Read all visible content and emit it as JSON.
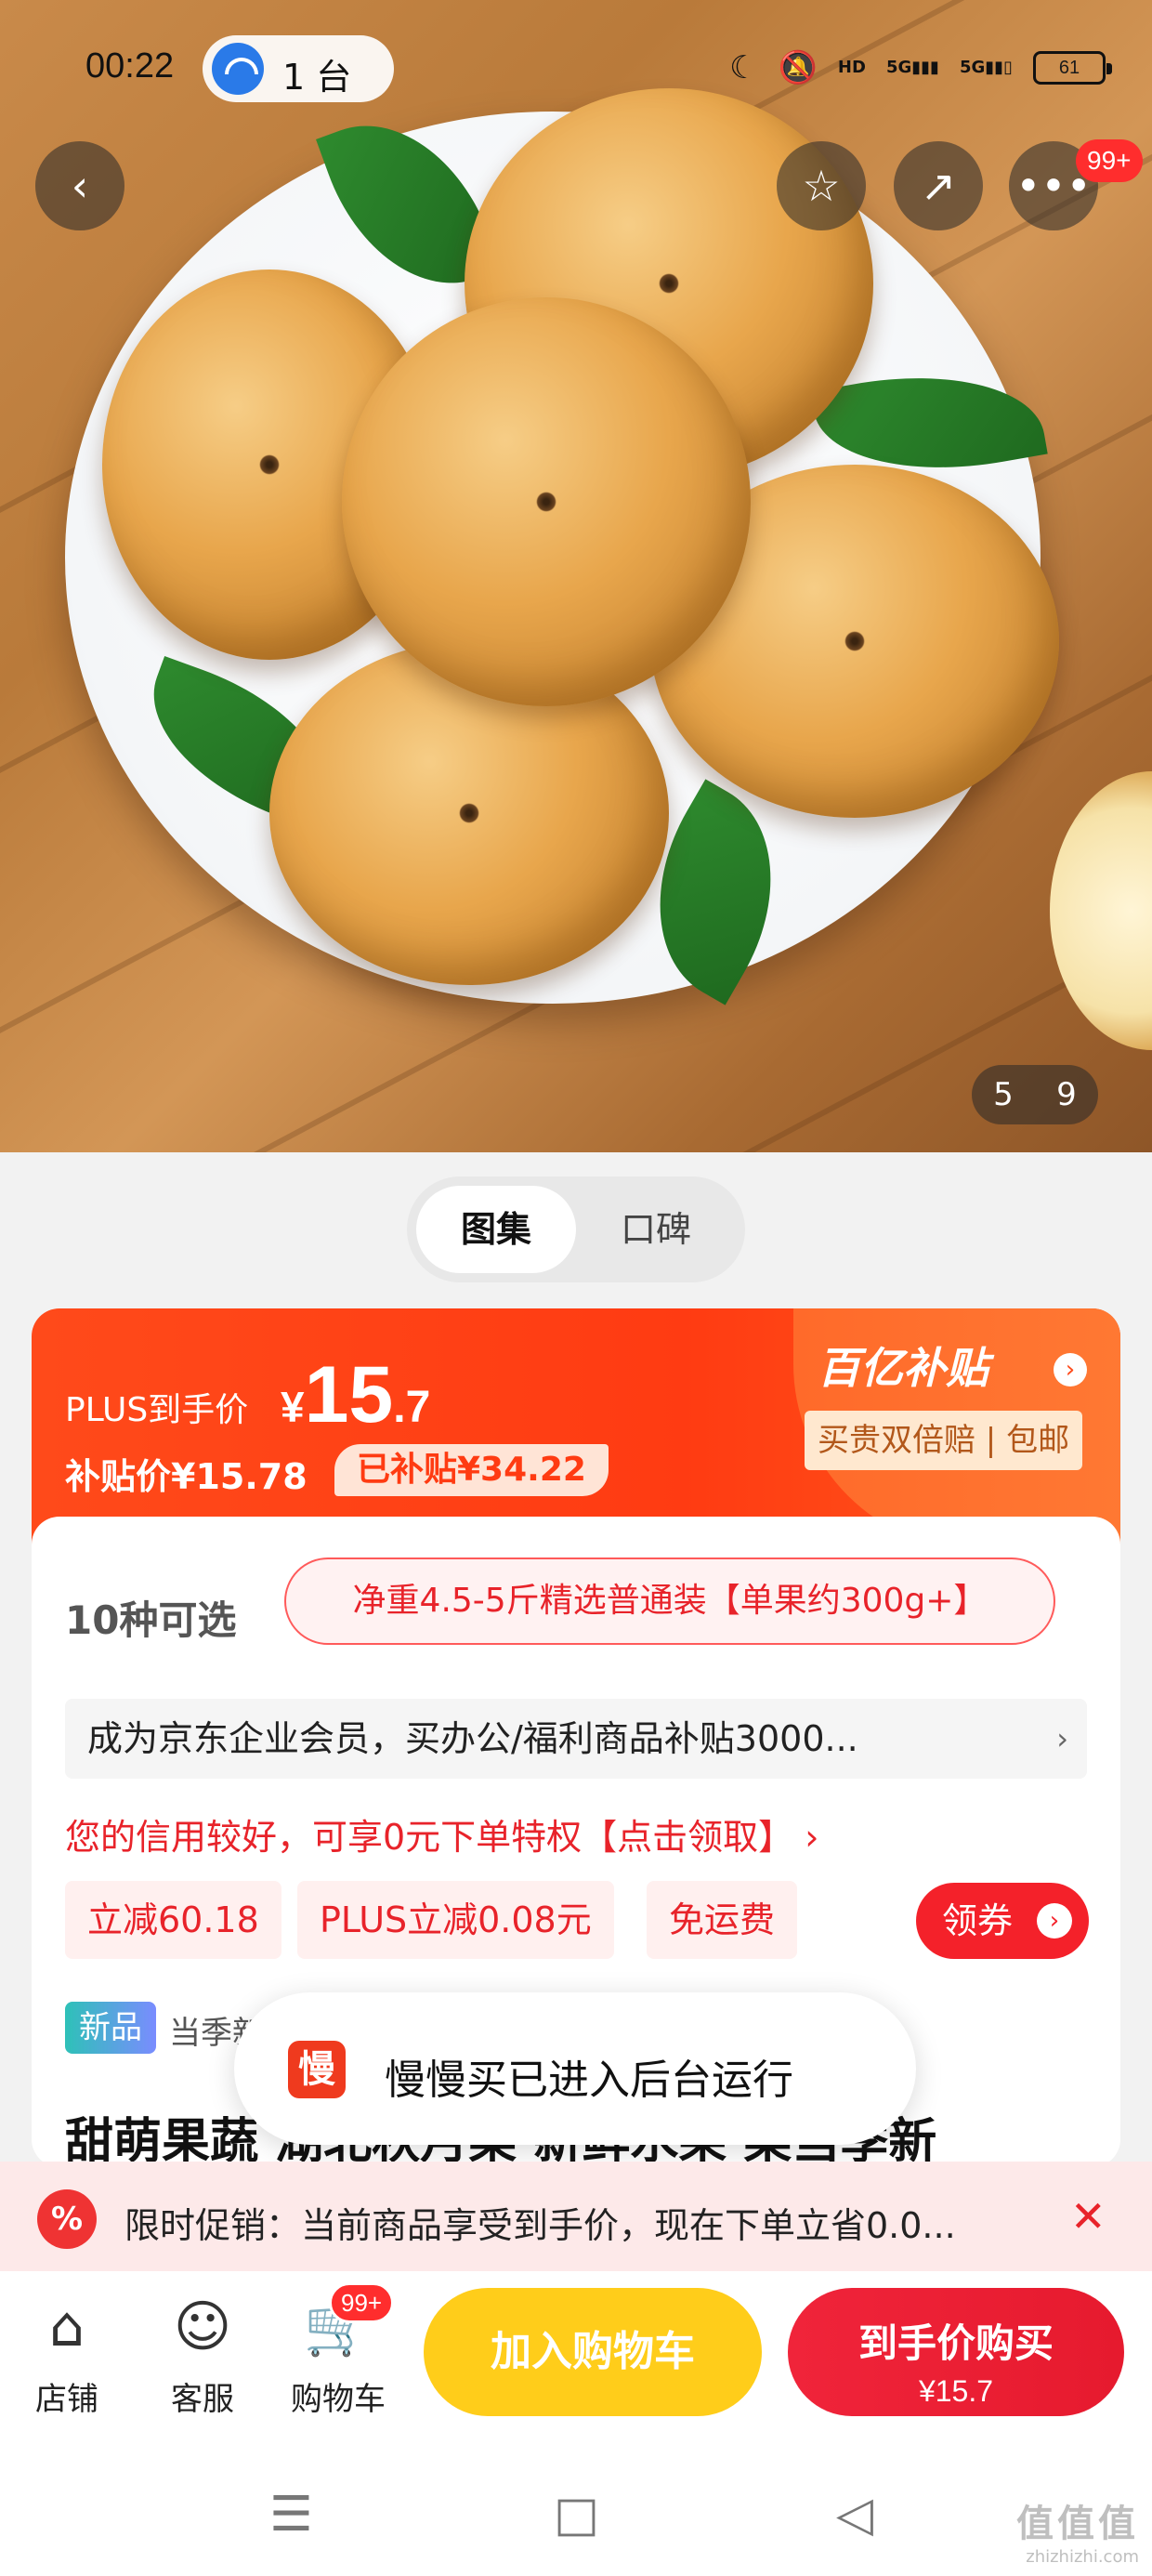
{
  "status_bar": {
    "time": "00:22",
    "hotspot_count": "1 台",
    "icons": [
      "moon-icon",
      "mute-icon",
      "hd-icon",
      "5g-signal-icon",
      "5g-signal-icon"
    ],
    "hd_label": "HD",
    "signal1": "5G",
    "signal2": "5G",
    "battery": "61"
  },
  "hero": {
    "cart_badge": "99+",
    "image_index": "5",
    "image_total": "9"
  },
  "tabs": [
    {
      "label": "图集",
      "active": true
    },
    {
      "label": "口碑",
      "active": false
    }
  ],
  "price_banner": {
    "plus_label": "PLUS到手价",
    "currency": "¥",
    "price_int": "15",
    "price_dec": ".7",
    "subsidy_price": "补贴价¥15.78",
    "subsidy_tag": "已补贴¥34.22",
    "program_title": "百亿补贴",
    "guarantee": "买贵双倍赔 | 包邮"
  },
  "details": {
    "variant_count": "10种可选",
    "variant_selected": "净重4.5-5斤精选普通装【单果约300g+】",
    "enterprise_promo": "成为京东企业会员，买办公/福利商品补贴3000...",
    "credit_promo": "您的信用较好，可享0元下单特权【点击领取】 ›",
    "coupons": [
      "立减60.18",
      "PLUS立减0.08元",
      "免运费"
    ],
    "coupon_button": "领券",
    "new_badge": "新品",
    "season_text": "当季新",
    "title": "甜萌果蔬 湖北秋月梨 新鲜水果 梨当季新"
  },
  "toast": {
    "icon_char": "慢",
    "message": "慢慢买已进入后台运行"
  },
  "promo_bar": {
    "icon_char": "%",
    "text": "限时促销：当前商品享受到手价，现在下单立省0.0..."
  },
  "action_bar": {
    "nav": [
      {
        "label": "店铺",
        "icon": "store-icon"
      },
      {
        "label": "客服",
        "icon": "service-icon"
      },
      {
        "label": "购物车",
        "icon": "cart-icon"
      }
    ],
    "cart_badge": "99+",
    "add_cart": "加入购物车",
    "buy_label": "到手价购买",
    "buy_price": "¥15.7"
  },
  "watermark": {
    "big": "值值值",
    "small": "zhizhizhi.com"
  }
}
